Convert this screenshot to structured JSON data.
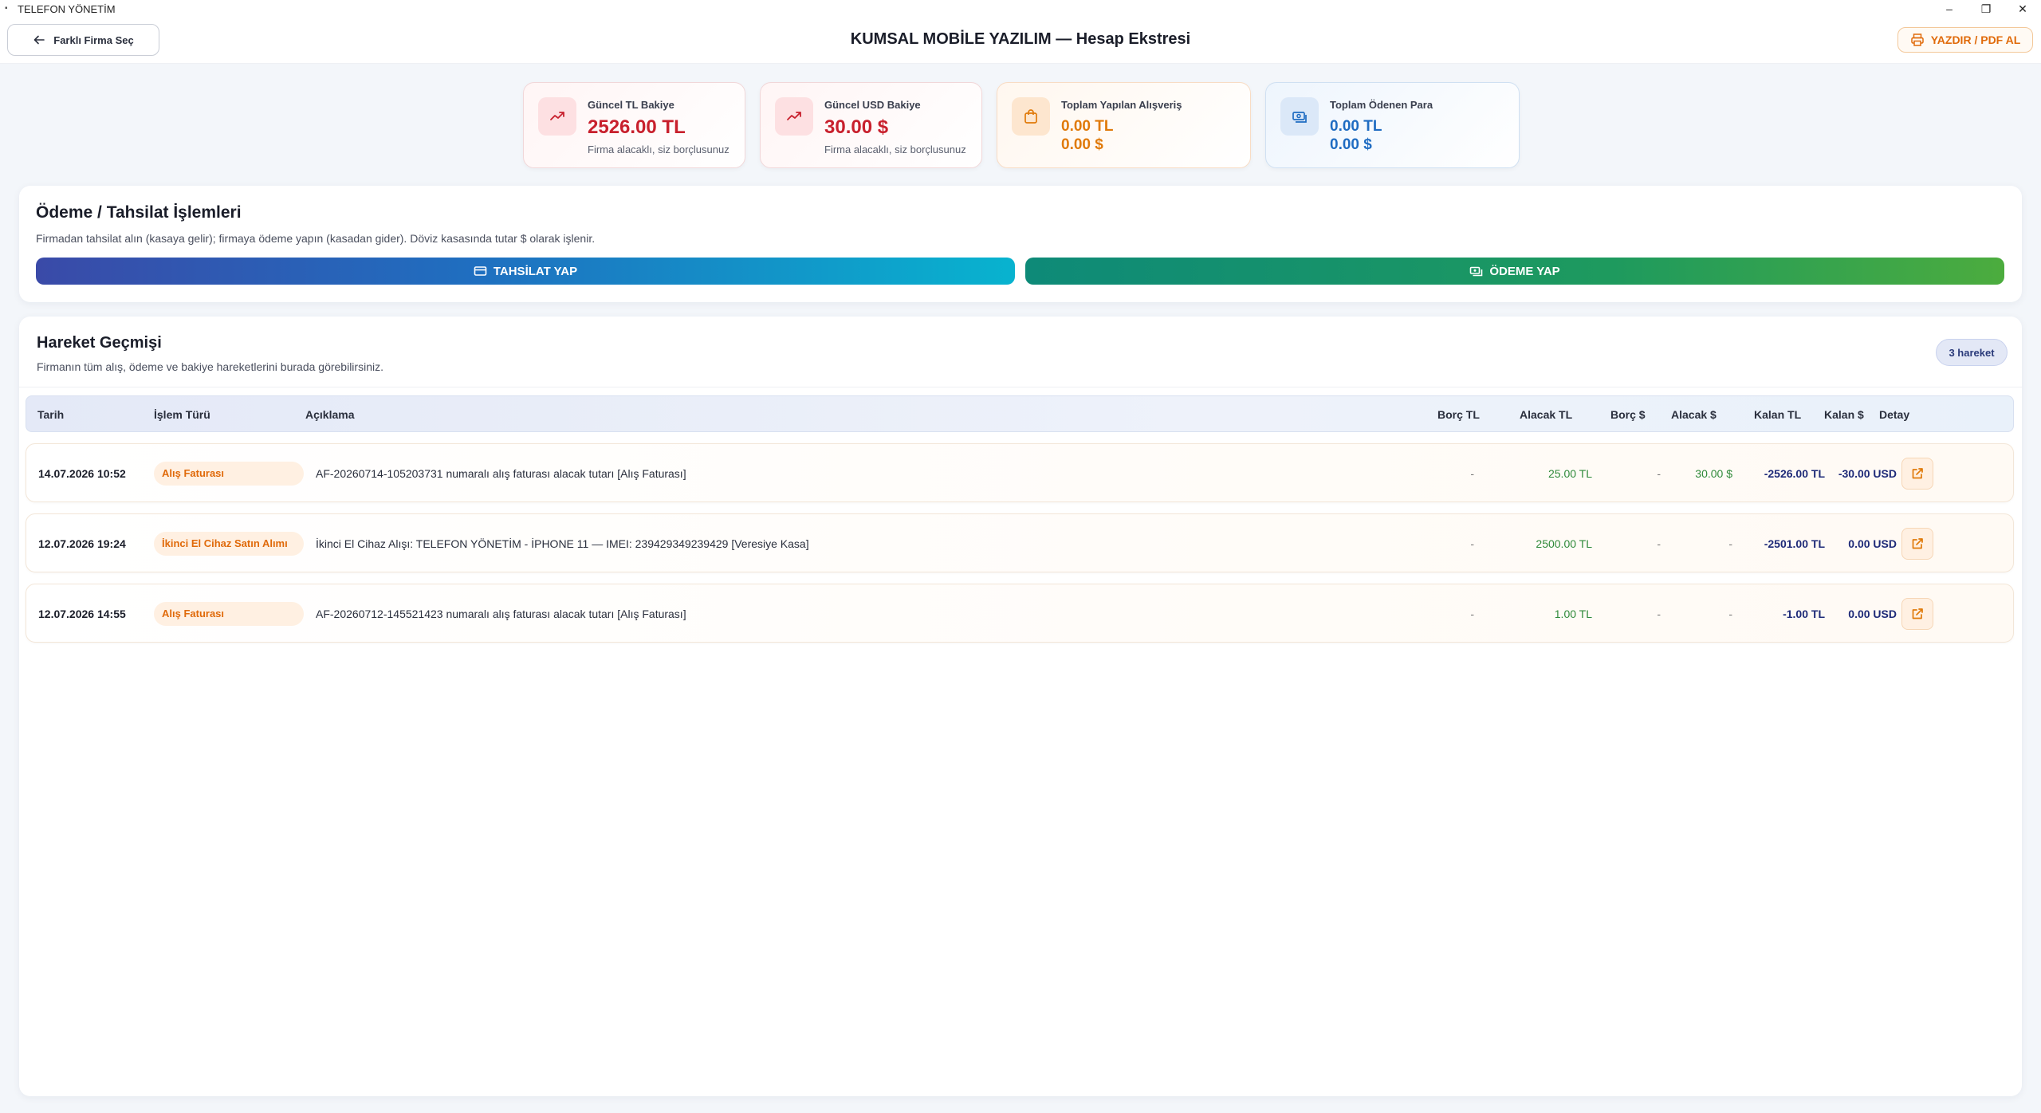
{
  "window": {
    "title": "TELEFON YÖNETİM",
    "minimize": "–",
    "maximize": "❐",
    "close": "✕"
  },
  "header": {
    "back_label": "Farklı Firma Seç",
    "title": "KUMSAL MOBİLE YAZILIM — Hesap Ekstresi",
    "print_label": "YAZDIR / PDF AL"
  },
  "cards": [
    {
      "label": "Güncel TL Bakiye",
      "value": "2526.00 TL",
      "note": "Firma alacaklı, siz borçlusunuz",
      "icon": "trending-up-icon"
    },
    {
      "label": "Güncel USD Bakiye",
      "value": "30.00 $",
      "note": "Firma alacaklı, siz borçlusunuz",
      "icon": "trending-up-icon"
    },
    {
      "label": "Toplam Yapılan Alışveriş",
      "value_tl": "0.00 TL",
      "value_usd": "0.00 $",
      "icon": "shopping-bag-icon"
    },
    {
      "label": "Toplam Ödenen Para",
      "value_tl": "0.00 TL",
      "value_usd": "0.00 $",
      "icon": "money-icon"
    }
  ],
  "payment": {
    "title": "Ödeme / Tahsilat İşlemleri",
    "description": "Firmadan tahsilat alın (kasaya gelir); firmaya ödeme yapın (kasadan gider). Döviz kasasında tutar $ olarak işlenir.",
    "collect_label": "TAHSİLAT YAP",
    "pay_label": "ÖDEME YAP"
  },
  "history": {
    "title": "Hareket Geçmişi",
    "description": "Firmanın tüm alış, ödeme ve bakiye hareketlerini burada görebilirsiniz.",
    "count_badge": "3 hareket",
    "columns": {
      "date": "Tarih",
      "type": "İşlem Türü",
      "desc": "Açıklama",
      "borc_tl": "Borç TL",
      "alacak_tl": "Alacak TL",
      "borc_usd": "Borç $",
      "alacak_usd": "Alacak $",
      "kalan_tl": "Kalan TL",
      "kalan_usd": "Kalan $",
      "detail": "Detay"
    },
    "rows": [
      {
        "date": "14.07.2026 10:52",
        "type": "Alış Faturası",
        "desc": "AF-20260714-105203731 numaralı alış faturası alacak tutarı [Alış Faturası]",
        "borc_tl": "-",
        "alacak_tl": "25.00 TL",
        "borc_usd": "-",
        "alacak_usd": "30.00 $",
        "kalan_tl": "-2526.00 TL",
        "kalan_usd": "-30.00 USD"
      },
      {
        "date": "12.07.2026 19:24",
        "type": "İkinci El Cihaz Satın Alımı",
        "desc": "İkinci El Cihaz Alışı: TELEFON YÖNETİM - İPHONE 11 — IMEI: 239429349239429 [Veresiye Kasa]",
        "borc_tl": "-",
        "alacak_tl": "2500.00 TL",
        "borc_usd": "-",
        "alacak_usd": "-",
        "kalan_tl": "-2501.00 TL",
        "kalan_usd": "0.00 USD"
      },
      {
        "date": "12.07.2026 14:55",
        "type": "Alış Faturası",
        "desc": "AF-20260712-145521423 numaralı alış faturası alacak tutarı [Alış Faturası]",
        "borc_tl": "-",
        "alacak_tl": "1.00 TL",
        "borc_usd": "-",
        "alacak_usd": "-",
        "kalan_tl": "-1.00 TL",
        "kalan_usd": "0.00 USD"
      }
    ]
  }
}
